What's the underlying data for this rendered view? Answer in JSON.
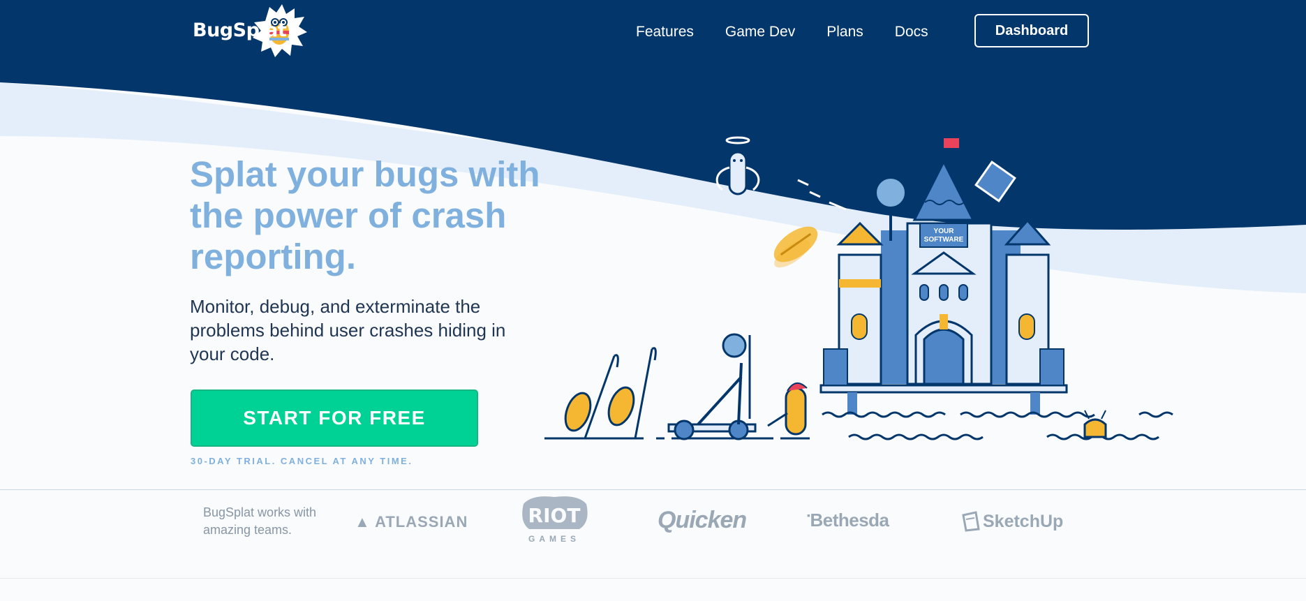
{
  "header": {
    "logo_text": "BugSplat",
    "nav": [
      {
        "label": "Features"
      },
      {
        "label": "Game Dev"
      },
      {
        "label": "Plans"
      },
      {
        "label": "Docs"
      }
    ],
    "dashboard_label": "Dashboard"
  },
  "hero": {
    "title": "Splat your bugs with the power of crash reporting.",
    "subtitle": "Monitor, debug, and exterminate the problems behind user crashes hiding in your code.",
    "cta_label": "START FOR FREE",
    "trial_note": "30-DAY TRIAL. CANCEL AT ANY TIME.",
    "castle_sign": "YOUR SOFTWARE"
  },
  "partners": {
    "intro": "BugSplat works with amazing teams.",
    "logos": [
      {
        "name": "ATLASSIAN"
      },
      {
        "name": "RIOT",
        "caption": "GAMES"
      },
      {
        "name": "Quicken"
      },
      {
        "name": "Bethesda"
      },
      {
        "name": "SketchUp"
      }
    ]
  },
  "colors": {
    "navy": "#03366b",
    "wave_light": "#e3eefa",
    "title_blue": "#80b1de",
    "cta_green": "#00d296",
    "bug_yellow": "#f5b731",
    "flag_red": "#e8435a"
  },
  "icons": [
    "bugsplat-logo-mascot-icon",
    "castle-illustration",
    "catapult-icon",
    "flag-icon",
    "magnifier-icon"
  ]
}
